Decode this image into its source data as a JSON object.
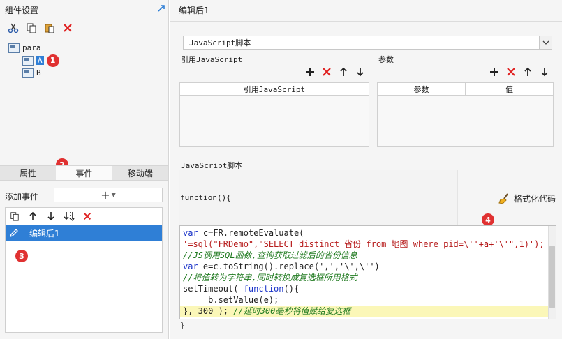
{
  "left": {
    "title": "组件设置",
    "toolbar_icons": [
      "cut-icon",
      "copy-icon",
      "paste-icon",
      "delete-icon"
    ],
    "tree": [
      {
        "label": "para",
        "level": 0
      },
      {
        "label": "A",
        "level": 1,
        "selected": true
      },
      {
        "label": "B",
        "level": 1
      }
    ],
    "tabs": [
      "属性",
      "事件",
      "移动端"
    ],
    "active_tab": "事件",
    "add_event_label": "添加事件",
    "add_event_button": "+",
    "event_toolbar_icons": [
      "copy-icon",
      "arrow-up-icon",
      "arrow-down-icon",
      "move-bottom-icon",
      "delete-icon"
    ],
    "events": [
      {
        "label": "编辑后1",
        "selected": true
      }
    ]
  },
  "badges": {
    "b1": "1",
    "b2": "2",
    "b3": "3",
    "b4": "4"
  },
  "right": {
    "title": "编辑后1",
    "type_select": "JavaScript脚本",
    "ref_js_label": "引用JavaScript",
    "params_label": "参数",
    "ref_js_header": "引用JavaScript",
    "params_headers": [
      "参数",
      "值"
    ],
    "js_script_label": "JavaScript脚本",
    "func_open": "function(){",
    "func_close": "}",
    "format_button": "格式化代码",
    "code": {
      "l1_kw": "var",
      "l1_rest": " c=FR.remoteEvaluate(",
      "l2": "'=sql(\"FRDemo\",\"SELECT distinct 省份 from 地图 where pid=\\''+a+'\\'\",1)');",
      "l3": "//JS调用SQL函数,查询获取过滤后的省份信息",
      "l4_kw": "var",
      "l4_rest": " e=c.toString().replace(',','\\',\\'')",
      "l5": "//将值转为字符串,同时转换成复选框所用格式",
      "l6_a": "setTimeout( ",
      "l6_kw": "function",
      "l6_b": "(){",
      "l7": "     b.setValue(e);",
      "l8_a": "}, 300 ); ",
      "l8_cm": "//延时300毫秒将值赋给复选框"
    }
  },
  "colors": {
    "accent": "#2f7fd6",
    "delete": "#e02020",
    "badge": "#e03131",
    "highlight": "#fbf7b8"
  }
}
